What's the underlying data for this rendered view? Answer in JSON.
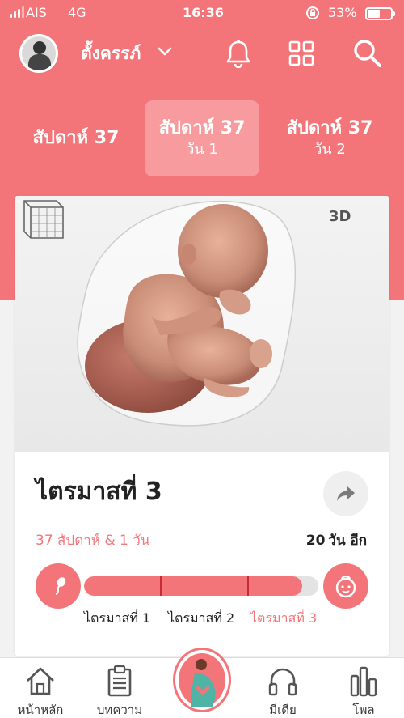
{
  "status_bar": {
    "carrier": "AIS",
    "network": "4G",
    "time": "16:36",
    "battery_percent": "53%",
    "battery_level": 0.53
  },
  "header": {
    "profile_name": "ตั้งครรภ์",
    "icons": [
      "bell-icon",
      "grid-icon",
      "search-icon"
    ]
  },
  "week_tabs": [
    {
      "week": "สัปดาห์ 37",
      "day": ""
    },
    {
      "week": "สัปดาห์ 37",
      "day": "วัน 1"
    },
    {
      "week": "สัปดาห์ 37",
      "day": "วัน 2"
    }
  ],
  "card": {
    "badge_3d": "3D",
    "trimester_title": "ไตรมาสที่ 3",
    "weeks_count": "37 สัปดาห์ & 1 วัน",
    "days_left_num": "20",
    "days_left_text": "วัน อีก",
    "progress": 0.93,
    "trimester_labels": [
      "ไตรมาสที่ 1",
      "ไตรมาสที่ 2",
      "ไตรมาสที่ 3"
    ]
  },
  "bottom_nav": {
    "home": "หน้าหลัก",
    "articles": "บทความ",
    "media": "มีเดีย",
    "polls": "โพล"
  },
  "colors": {
    "brand": "#f47579",
    "divider": "#c62c34"
  }
}
